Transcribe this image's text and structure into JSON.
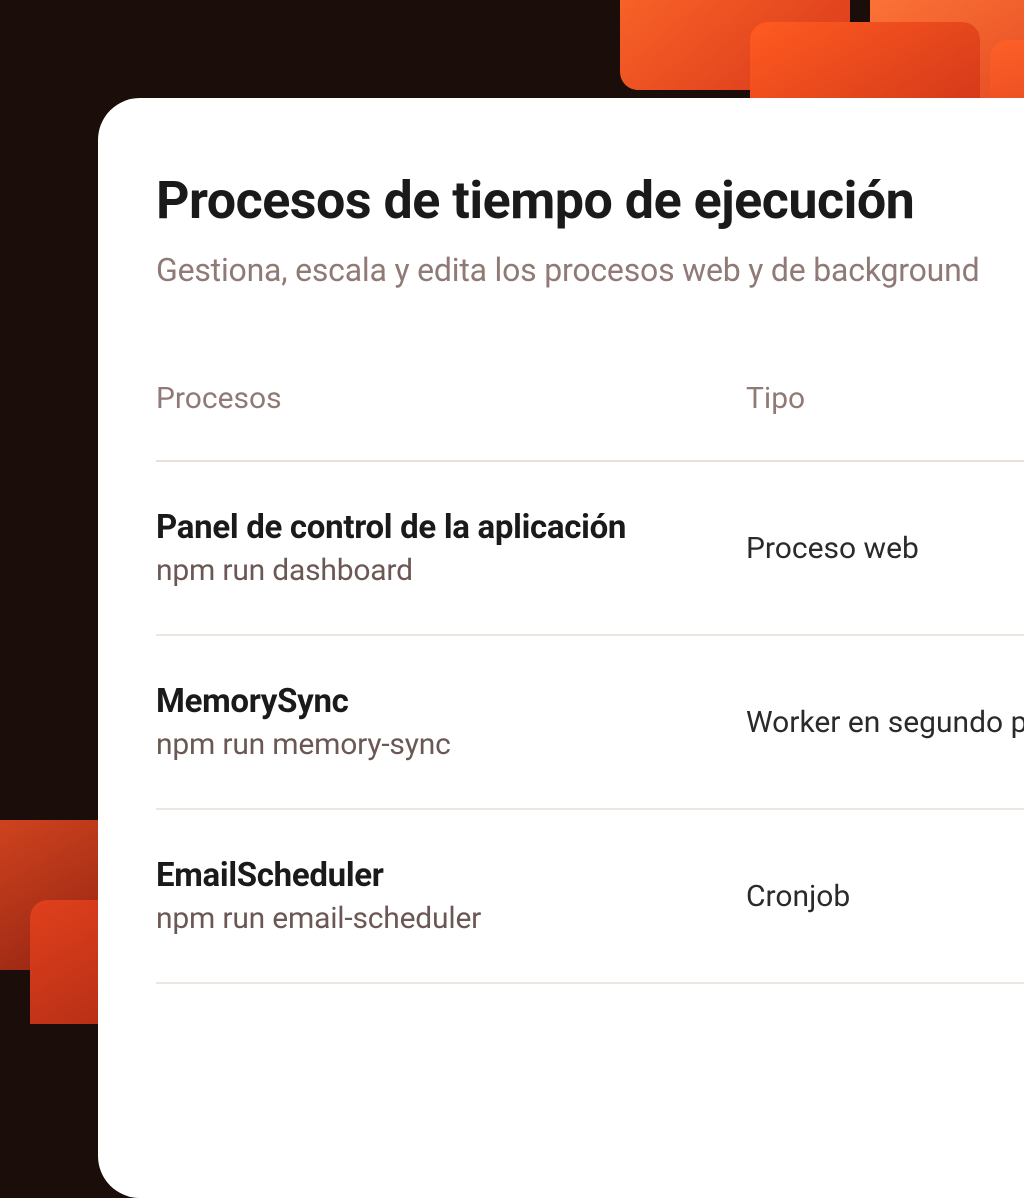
{
  "header": {
    "title": "Procesos de tiempo de ejecución",
    "subtitle": "Gestiona, escala y edita los procesos web y de background"
  },
  "table": {
    "columns": {
      "process": "Procesos",
      "type": "Tipo"
    },
    "rows": [
      {
        "name": "Panel de control de la aplicación",
        "command": "npm run dashboard",
        "type": "Proceso web"
      },
      {
        "name": "MemorySync",
        "command": "npm run memory-sync",
        "type": "Worker en segundo plano"
      },
      {
        "name": "EmailScheduler",
        "command": "npm run email-scheduler",
        "type": "Cronjob"
      }
    ]
  }
}
